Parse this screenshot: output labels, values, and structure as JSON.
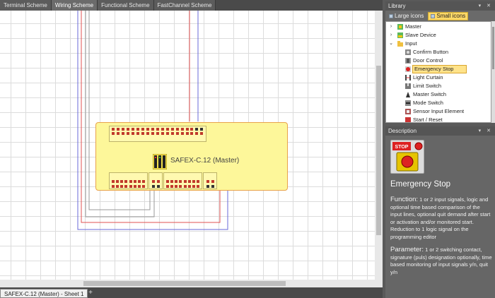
{
  "tabs": [
    "Terminal Scheme",
    "Wiring Scheme",
    "Functional Scheme",
    "FastChannel Scheme"
  ],
  "module": {
    "title": "SAFEX-C.12 (Master)"
  },
  "sheet": {
    "tab_label": "SAFEX-C.12 (Master) - Sheet 1",
    "add_label": "+"
  },
  "library": {
    "title": "Library",
    "controls": "▾ ✕",
    "large_icons": "Large icons",
    "small_icons": "Small icons",
    "tree": [
      {
        "label": "Master",
        "chev": "›",
        "icon": "master-icon"
      },
      {
        "label": "Slave Device",
        "chev": "›",
        "icon": "slave-device-icon"
      },
      {
        "label": "Input",
        "chev": "⌄",
        "icon": "folder-icon"
      },
      {
        "label": "Confirm Button",
        "chev": "",
        "icon": "confirm-button-icon"
      },
      {
        "label": "Door Control",
        "chev": "",
        "icon": "door-control-icon"
      },
      {
        "label": "Emergency Stop",
        "chev": "",
        "icon": "emergency-stop-icon"
      },
      {
        "label": "Light Curtain",
        "chev": "",
        "icon": "light-curtain-icon"
      },
      {
        "label": "Limit Switch",
        "chev": "",
        "icon": "limit-switch-icon"
      },
      {
        "label": "Master Switch",
        "chev": "",
        "icon": "master-switch-icon"
      },
      {
        "label": "Mode Switch",
        "chev": "",
        "icon": "mode-switch-icon"
      },
      {
        "label": "Sensor Input Element",
        "chev": "",
        "icon": "sensor-input-icon"
      },
      {
        "label": "Start / Reset",
        "chev": "",
        "icon": "start-reset-icon"
      }
    ]
  },
  "description": {
    "title": "Description",
    "controls": "▾ ✕",
    "icon_text": "STOP",
    "name": "Emergency Stop",
    "function_label": "Function:",
    "function_text": " 1 or 2 input signals, logic and optional time based comparison of the input lines, optional quit demand after start or activation and/or monitored start. Reduction to 1 logic signal on the programming editor",
    "parameter_label": "Parameter:",
    "parameter_text": " 1 or 2 switching contact, signature (puls) designation optionally, time based monitoring of input signals y/n, quit y/n"
  },
  "colors": {
    "module_fill": "#fdf79a",
    "module_border": "#e8a24a",
    "wire_red": "#e05050",
    "wire_blue": "#6a6ad8",
    "wire_grey": "#999999",
    "selection": "#ffe38a"
  }
}
